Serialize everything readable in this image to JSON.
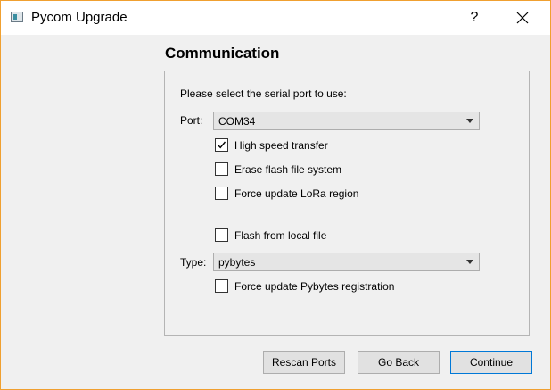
{
  "window": {
    "title": "Pycom Upgrade",
    "help_label": "?"
  },
  "page": {
    "title": "Communication",
    "instruction": "Please select the serial port to use:"
  },
  "port": {
    "label": "Port:",
    "value": "COM34"
  },
  "options": {
    "high_speed": {
      "label": "High speed transfer",
      "checked": true
    },
    "erase_flash": {
      "label": "Erase flash file system",
      "checked": false
    },
    "force_lora": {
      "label": "Force update LoRa region",
      "checked": false
    },
    "flash_local": {
      "label": "Flash from local file",
      "checked": false
    },
    "force_pybytes": {
      "label": "Force update Pybytes registration",
      "checked": false
    }
  },
  "type": {
    "label": "Type:",
    "value": "pybytes"
  },
  "buttons": {
    "rescan": "Rescan Ports",
    "back": "Go Back",
    "continue": "Continue"
  },
  "colors": {
    "accent": "#0078d7",
    "window_border": "#f0a030"
  }
}
